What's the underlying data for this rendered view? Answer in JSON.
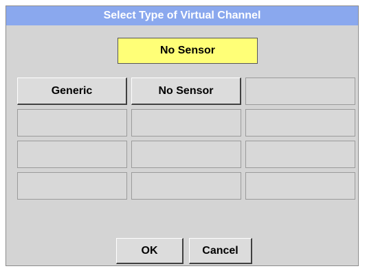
{
  "dialog": {
    "title": "Select Type of Virtual Channel",
    "selected_value": "No Sensor",
    "grid": [
      [
        "Generic",
        "No Sensor",
        ""
      ],
      [
        "",
        "",
        ""
      ],
      [
        "",
        "",
        ""
      ],
      [
        "",
        "",
        ""
      ]
    ],
    "ok_label": "OK",
    "cancel_label": "Cancel"
  },
  "colors": {
    "titlebar": "#8aa8ee",
    "dialog_background": "#d4d4d4",
    "selected_display": "#ffff77"
  }
}
